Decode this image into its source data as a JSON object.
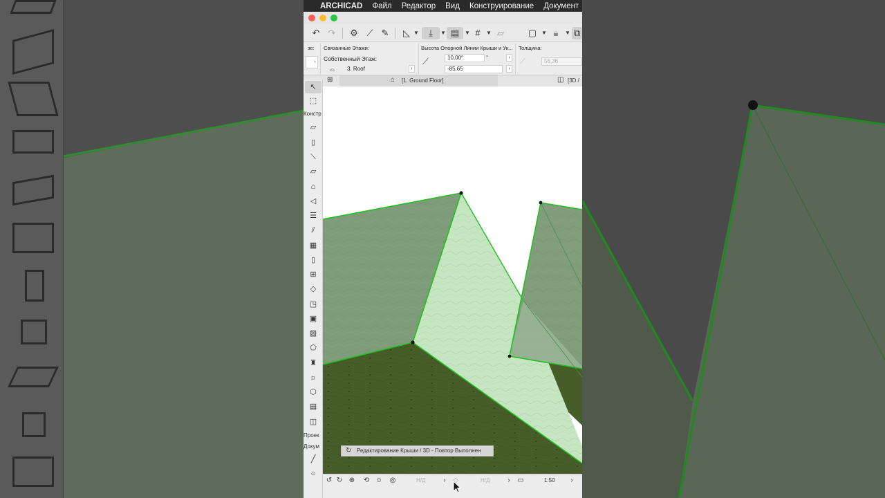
{
  "menubar": {
    "app_name": "ARCHICAD",
    "items": [
      "Файл",
      "Редактор",
      "Вид",
      "Конструирование",
      "Документ"
    ]
  },
  "infobox": {
    "cut_label": "зе:",
    "linked_stories_label": "Связанные Этажи:",
    "home_story_label": "Собственный Этаж:",
    "home_story_value": "3. Roof",
    "pivot_label": "Высота Опорной Линии Крыши и Ук...",
    "angle_value": "10,00°",
    "degree_unit": "°",
    "height_value": "-85,65",
    "thickness_label": "Толщина:",
    "thickness_value": "56,36"
  },
  "tabs": {
    "floor_plan": "[1. Ground Floor]",
    "view_3d": "[3D /"
  },
  "toolbox": {
    "design_header": "Констр",
    "view_header": "Проек",
    "document_header": "Докум"
  },
  "notification": {
    "text": "Редактирование Крыши / 3D - Повтор Выполнен"
  },
  "statusbar": {
    "na_1": "Н/Д",
    "na_2": "Н/Д",
    "scale": "1:50"
  },
  "colors": {
    "roof_edge": "#22c022",
    "roof_fill": "#7f9c7a",
    "roof_light": "#c6e6c2",
    "ground": "#465d2a",
    "window_bg": "#ececec"
  }
}
